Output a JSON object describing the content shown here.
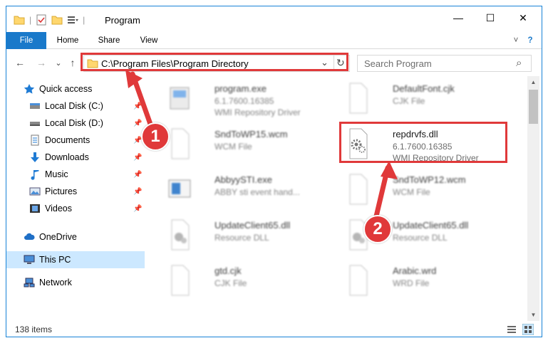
{
  "window": {
    "title": "Program",
    "minimize_glyph": "—",
    "maximize_glyph": "☐",
    "close_glyph": "✕",
    "help_glyph": "?",
    "collapse_glyph": "˅"
  },
  "ribbon": {
    "tabs": [
      "File",
      "Home",
      "Share",
      "View"
    ]
  },
  "address": {
    "path": "C:\\Program Files\\Program Directory",
    "dropdown_glyph": "⌄",
    "refresh_glyph": "↻"
  },
  "search": {
    "placeholder": "Search Program",
    "icon_glyph": "⌕"
  },
  "nav_glyphs": {
    "back": "←",
    "forward": "→",
    "recent": "⌄",
    "up": "↑"
  },
  "sidebar": {
    "items": [
      {
        "label": "Quick access",
        "icon": "star-icon"
      },
      {
        "label": "Local Disk (C:)",
        "icon": "drive-icon"
      },
      {
        "label": "Local Disk (D:)",
        "icon": "drive-icon"
      },
      {
        "label": "Documents",
        "icon": "documents-icon"
      },
      {
        "label": "Downloads",
        "icon": "download-icon"
      },
      {
        "label": "Music",
        "icon": "music-icon"
      },
      {
        "label": "Pictures",
        "icon": "pictures-icon"
      },
      {
        "label": "Videos",
        "icon": "videos-icon"
      },
      {
        "label": "OneDrive",
        "icon": "cloud-icon"
      },
      {
        "label": "This PC",
        "icon": "computer-icon"
      },
      {
        "label": "Network",
        "icon": "network-icon"
      }
    ],
    "pin_glyph": "📌"
  },
  "files": [
    {
      "name": "program.exe",
      "version": "6.1.7600.16385",
      "desc": "WMI Repository Driver"
    },
    {
      "name": "DefaultFont.cjk",
      "version": "CJK File",
      "desc": ""
    },
    {
      "name": "SndToWP15.wcm",
      "version": "WCM File",
      "desc": ""
    },
    {
      "name": "repdrvfs.dll",
      "version": "6.1.7600.16385",
      "desc": "WMI Repository Driver"
    },
    {
      "name": "AbbyySTI.exe",
      "version": "ABBY sti event hand...",
      "desc": ""
    },
    {
      "name": "SndToWP12.wcm",
      "version": "WCM File",
      "desc": ""
    },
    {
      "name": "UpdateClient65.dll",
      "version": "Resource DLL",
      "desc": ""
    },
    {
      "name": "UpdateClient65.dll",
      "version": "Resource DLL",
      "desc": ""
    },
    {
      "name": "gtd.cjk",
      "version": "CJK File",
      "desc": ""
    },
    {
      "name": "Arabic.wrd",
      "version": "WRD File",
      "desc": ""
    }
  ],
  "status": {
    "items": "138 items"
  },
  "annotations": {
    "marker1": "1",
    "marker2": "2",
    "color": "#e0393a"
  }
}
